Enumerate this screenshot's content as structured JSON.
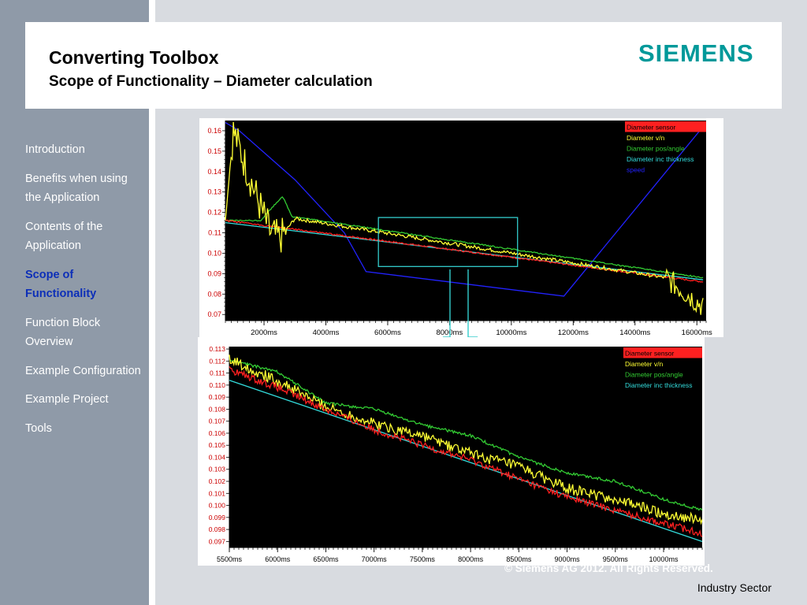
{
  "slide": {
    "title": "Converting Toolbox",
    "subtitle": "Scope of Functionality – Diameter calculation",
    "logo": "SIEMENS",
    "copyright": "© Siemens AG 2012. All Rights Reserved.",
    "sector": "Industry Sector"
  },
  "sidebar": {
    "items": [
      {
        "label": "Introduction",
        "active": false
      },
      {
        "label": "Benefits when using the Application",
        "active": false
      },
      {
        "label": "Contents of the Application",
        "active": false
      },
      {
        "label": "Scope of Functionality",
        "active": true
      },
      {
        "label": "Function Block Overview",
        "active": false
      },
      {
        "label": "Example Configuration",
        "active": false
      },
      {
        "label": "Example Project",
        "active": false
      },
      {
        "label": "Tools",
        "active": false
      }
    ]
  },
  "colors": {
    "sensor": "#ff2020",
    "vn": "#ffff33",
    "pos": "#33cc33",
    "thick": "#33dddd",
    "speed": "#2222ff",
    "plotbg": "#000000",
    "axisText": "#cc0000",
    "zoomBox": "#33cccc",
    "logo": "#00999a",
    "activeNav": "#0d2fb8"
  },
  "chart_data": [
    {
      "type": "line",
      "title": "",
      "xlabel": "",
      "ylabel": "",
      "xlim": [
        750,
        16300
      ],
      "ylim": [
        0.067,
        0.165
      ],
      "x_tick_labels": [
        "2000ms",
        "4000ms",
        "6000ms",
        "8000ms",
        "10000ms",
        "12000ms",
        "14000ms",
        "16000ms"
      ],
      "x_ticks": [
        2000,
        4000,
        6000,
        8000,
        10000,
        12000,
        14000,
        16000
      ],
      "y_tick_labels": [
        "0.16",
        "0.15",
        "0.14",
        "0.13",
        "0.12",
        "0.11",
        "0.10",
        "0.09",
        "0.08",
        "0.07"
      ],
      "y_ticks": [
        0.16,
        0.15,
        0.14,
        0.13,
        0.12,
        0.11,
        0.1,
        0.09,
        0.08,
        0.07
      ],
      "legend": [
        "Diameter sensor",
        "Diameter v/n",
        "Diameter pos/angle",
        "Diameter inc thickness",
        "speed"
      ],
      "legend_position": "top-right",
      "grid": false,
      "zoom_box_x": [
        5700,
        10200
      ],
      "zoom_box_y": [
        0.0935,
        0.1175
      ],
      "series": [
        {
          "name": "speed",
          "x": [
            750,
            1200,
            3000,
            4600,
            5300,
            11700,
            16200
          ],
          "y": [
            0.164,
            0.16,
            0.136,
            0.11,
            0.091,
            0.079,
            0.162
          ]
        },
        {
          "name": "Diameter inc thickness",
          "x": [
            750,
            16200
          ],
          "y": [
            0.115,
            0.087
          ]
        },
        {
          "name": "Diameter pos/angle",
          "x": [
            750,
            1900,
            2000,
            2600,
            2900,
            16200
          ],
          "y": [
            0.116,
            0.116,
            0.118,
            0.128,
            0.118,
            0.088
          ]
        },
        {
          "name": "Diameter sensor",
          "x": [
            750,
            16200
          ],
          "y": [
            0.116,
            0.086
          ]
        },
        {
          "name": "Diameter v/n",
          "x": [
            750,
            1000,
            1800,
            2200,
            2500,
            3000,
            15000,
            16200
          ],
          "y": [
            0.116,
            0.16,
            0.126,
            0.11,
            0.107,
            0.117,
            0.088,
            0.074
          ]
        }
      ]
    },
    {
      "type": "line",
      "title": "",
      "xlabel": "",
      "ylabel": "",
      "xlim": [
        5500,
        10400
      ],
      "ylim": [
        0.0965,
        0.1132
      ],
      "x_tick_labels": [
        "5500ms",
        "6000ms",
        "6500ms",
        "7000ms",
        "7500ms",
        "8000ms",
        "8500ms",
        "9000ms",
        "9500ms",
        "10000ms"
      ],
      "x_ticks": [
        5500,
        6000,
        6500,
        7000,
        7500,
        8000,
        8500,
        9000,
        9500,
        10000
      ],
      "y_tick_labels": [
        "0.113",
        "0.112",
        "0.111",
        "0.110",
        "0.109",
        "0.108",
        "0.107",
        "0.106",
        "0.105",
        "0.104",
        "0.103",
        "0.102",
        "0.101",
        "0.100",
        "0.099",
        "0.098",
        "0.097"
      ],
      "y_ticks": [
        0.113,
        0.112,
        0.111,
        0.11,
        0.109,
        0.108,
        0.107,
        0.106,
        0.105,
        0.104,
        0.103,
        0.102,
        0.101,
        0.1,
        0.099,
        0.098,
        0.097
      ],
      "legend": [
        "Diameter sensor",
        "Diameter v/n",
        "Diameter pos/angle",
        "Diameter inc thickness"
      ],
      "legend_position": "top-right",
      "grid": false,
      "series": [
        {
          "name": "Diameter inc thickness",
          "x": [
            5500,
            10400
          ],
          "y": [
            0.1104,
            0.097
          ]
        },
        {
          "name": "Diameter pos/angle",
          "x": [
            5500,
            6000,
            6500,
            7000,
            7500,
            8000,
            8500,
            9000,
            9500,
            10000,
            10400
          ],
          "y": [
            0.1121,
            0.1111,
            0.1085,
            0.108,
            0.1067,
            0.1058,
            0.104,
            0.1027,
            0.102,
            0.1005,
            0.0996
          ]
        },
        {
          "name": "Diameter v/n",
          "x": [
            5500,
            6000,
            6500,
            7000,
            7500,
            8000,
            8500,
            9000,
            9500,
            10000,
            10400
          ],
          "y": [
            0.1122,
            0.1103,
            0.1082,
            0.1068,
            0.1058,
            0.1043,
            0.1032,
            0.1014,
            0.1005,
            0.0993,
            0.0988
          ]
        },
        {
          "name": "Diameter sensor",
          "x": [
            5500,
            6000,
            6500,
            7000,
            7500,
            8000,
            8500,
            9000,
            9500,
            10000,
            10400
          ],
          "y": [
            0.1113,
            0.1098,
            0.108,
            0.1063,
            0.105,
            0.1038,
            0.1022,
            0.1007,
            0.0996,
            0.0985,
            0.0977
          ]
        }
      ]
    }
  ]
}
